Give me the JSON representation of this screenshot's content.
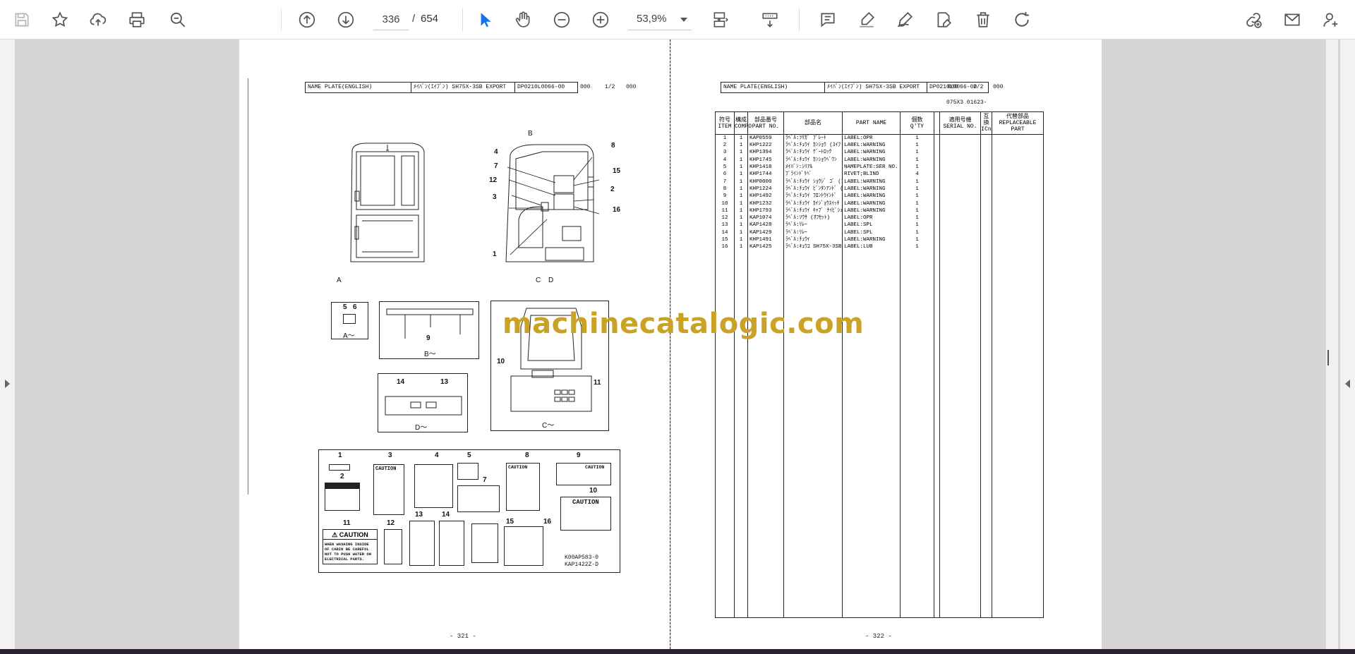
{
  "toolbar": {
    "current_page": "336",
    "page_separator": "/",
    "total_pages": "654",
    "zoom": "53,9%"
  },
  "icons": {
    "left": [
      "save-icon",
      "bookmark-star-icon",
      "upload-cloud-icon",
      "print-icon",
      "search-zoom-icon"
    ],
    "nav": [
      "previous-page-icon",
      "next-page-icon"
    ],
    "tools": [
      "select-cursor-icon",
      "hand-pan-icon",
      "zoom-out-icon",
      "zoom-in-icon",
      "fit-page-icon",
      "page-scroll-icon"
    ],
    "annotate": [
      "comment-icon",
      "highlight-pen-icon",
      "draw-sign-icon",
      "fill-sign-icon",
      "delete-icon",
      "rotate-icon"
    ],
    "right": [
      "share-link-icon",
      "email-icon",
      "add-user-icon"
    ],
    "accent_color": "#1473e6"
  },
  "left_page": {
    "header": {
      "name": "NAME PLATE(ENGLISH)",
      "desc": "ﾒｲﾊﾞﾝ(ｴｲﾌﾞﾝ) SH75X-3SB EXPORT",
      "code": "DP0210L0066-00",
      "seq": "000",
      "page": "1/2",
      "tail": "000"
    },
    "view_labels": [
      "B",
      "A",
      "C",
      "D",
      "A～",
      "B～",
      "C～",
      "D～"
    ],
    "callouts": [
      "4",
      "7",
      "12",
      "3",
      "1",
      "8",
      "15",
      "2",
      "16",
      "5",
      "6",
      "9",
      "10",
      "11",
      "14",
      "13"
    ],
    "label_sheet_numbers": [
      "1",
      "2",
      "3",
      "4",
      "5",
      "7",
      "8",
      "9",
      "10",
      "11",
      "12",
      "13",
      "14",
      "15",
      "16"
    ],
    "decal_texts": [
      "CAUTION",
      "CAUTION",
      "CAUTION",
      "CAUTION",
      "WHEN WASHING INSIDE OF CABIN BE CAREFUL NOT TO PUSH WATER ON ELECTRICAL PARTS."
    ],
    "drawing_refs": [
      "K00AP583-0",
      "KAP1422Z-D"
    ],
    "page_number": "- 321 -"
  },
  "right_page": {
    "header": {
      "name": "NAME PLATE(ENGLISH)",
      "desc": "ﾒｲﾊﾞﾝ(ｴｲﾌﾞﾝ) SH75X-3SB EXPORT",
      "code": "DP0210L0066-00",
      "seq": "000",
      "page": "2/2",
      "tail": "000"
    },
    "model_code": "075X3 01623-",
    "table_headers": [
      {
        "jp": "符号",
        "en": "ITEM"
      },
      {
        "jp": "構成",
        "en": "COMPO"
      },
      {
        "jp": "部品番号",
        "en": "PART NO."
      },
      {
        "jp": "部品名",
        "en": ""
      },
      {
        "jp": "",
        "en": "PART NAME"
      },
      {
        "jp": "個数",
        "en": "Q'TY"
      },
      {
        "jp": "",
        "en": ""
      },
      {
        "jp": "適用号機",
        "en": "SERIAL NO."
      },
      {
        "jp": "互換",
        "en": "ICn"
      },
      {
        "jp": "代替部品",
        "en": "REPLACEABLE PART"
      }
    ],
    "rows": [
      [
        "1",
        "1",
        "KAP0559",
        "ﾗﾍﾞﾙ:ﾂﾘｶﾞ ﾌﾟﾚｰﾄ",
        "LABEL:OPR",
        "1"
      ],
      [
        "2",
        "1",
        "KHP1222",
        "ﾗﾍﾞﾙ:ﾁｭｳｲ ｶﾝｼｮｳ (ｽｲﾌ",
        "LABEL:WARNING",
        "1"
      ],
      [
        "3",
        "1",
        "KHP1394",
        "ﾗﾍﾞﾙ:ﾁｭｳｲ ｹﾞｰﾄﾛｯｸ",
        "LABEL:WARNING",
        "1"
      ],
      [
        "4",
        "1",
        "KHP1745",
        "ﾗﾍﾞﾙ:ﾁｭｳｲ ｶﾝｼｮｳﾍﾞｳﾝ",
        "LABEL:WARNING",
        "1"
      ],
      [
        "5",
        "1",
        "KHP1418",
        "ﾒｲﾊﾞﾝ:ｼﾘｱﾙ",
        "NAMEPLATE:SER NO.",
        "1"
      ],
      [
        "6",
        "1",
        "KHP1744",
        "ﾌﾞﾗｲﾝﾄﾞﾘﾍﾞ",
        "RIVET;BLIND",
        "4"
      ],
      [
        "7",
        "1",
        "KHP0000",
        "ﾗﾍﾞﾙ:ﾁｭｳｲ ｼｮｳｼﾞ ｺﾞ (I",
        "LABEL:WARNING",
        "1"
      ],
      [
        "8",
        "1",
        "KHP1224",
        "ﾗﾍﾞﾙ:ﾁｭｳｲ ﾋﾟﾝﾀﾝｱﾝﾄﾞ (I",
        "LABEL:WARNING",
        "1"
      ],
      [
        "9",
        "1",
        "KHP1492",
        "ﾗﾍﾞﾙ:ﾁｭｳｲ ﾌﾛﾝﾄｳｲﾝﾄﾞ",
        "LABEL:WARNING",
        "1"
      ],
      [
        "10",
        "1",
        "KHP1232",
        "ﾗﾍﾞﾙ:ﾁｭｳｲ ｶｲｼﾞｮｳｽｲｯﾁ",
        "LABEL:WARNING",
        "1"
      ],
      [
        "11",
        "1",
        "KHP1793",
        "ﾗﾍﾞﾙ:ﾁｭｳｲ ｷｬﾌﾞ ﾅｲﾋﾞｼｭｳ",
        "LABEL:WARNING",
        "1"
      ],
      [
        "12",
        "1",
        "KAP1074",
        "ﾗﾍﾞﾙ:ｿｳｻ (ｵﾌｾｯﾄ)",
        "LABEL:OPR",
        "1"
      ],
      [
        "13",
        "1",
        "KAP1428",
        "ﾗﾍﾞﾙ:ﾘﾚｰ",
        "LABEL:SPL",
        "1"
      ],
      [
        "14",
        "1",
        "KAP1429",
        "ﾗﾍﾞﾙ:ﾘﾚｰ",
        "LABEL:SPL",
        "1"
      ],
      [
        "15",
        "1",
        "KHP1491",
        "ﾗﾍﾞﾙ:ﾁｭｳｲ",
        "LABEL:WARNING",
        "1"
      ],
      [
        "16",
        "1",
        "KAP1425",
        "ﾗﾍﾞﾙ:ｷｭｳﾕ SH75X-3SB",
        "LABEL:LUB",
        "1"
      ]
    ],
    "page_number": "- 322 -"
  },
  "watermark": "machinecatalogic.com"
}
